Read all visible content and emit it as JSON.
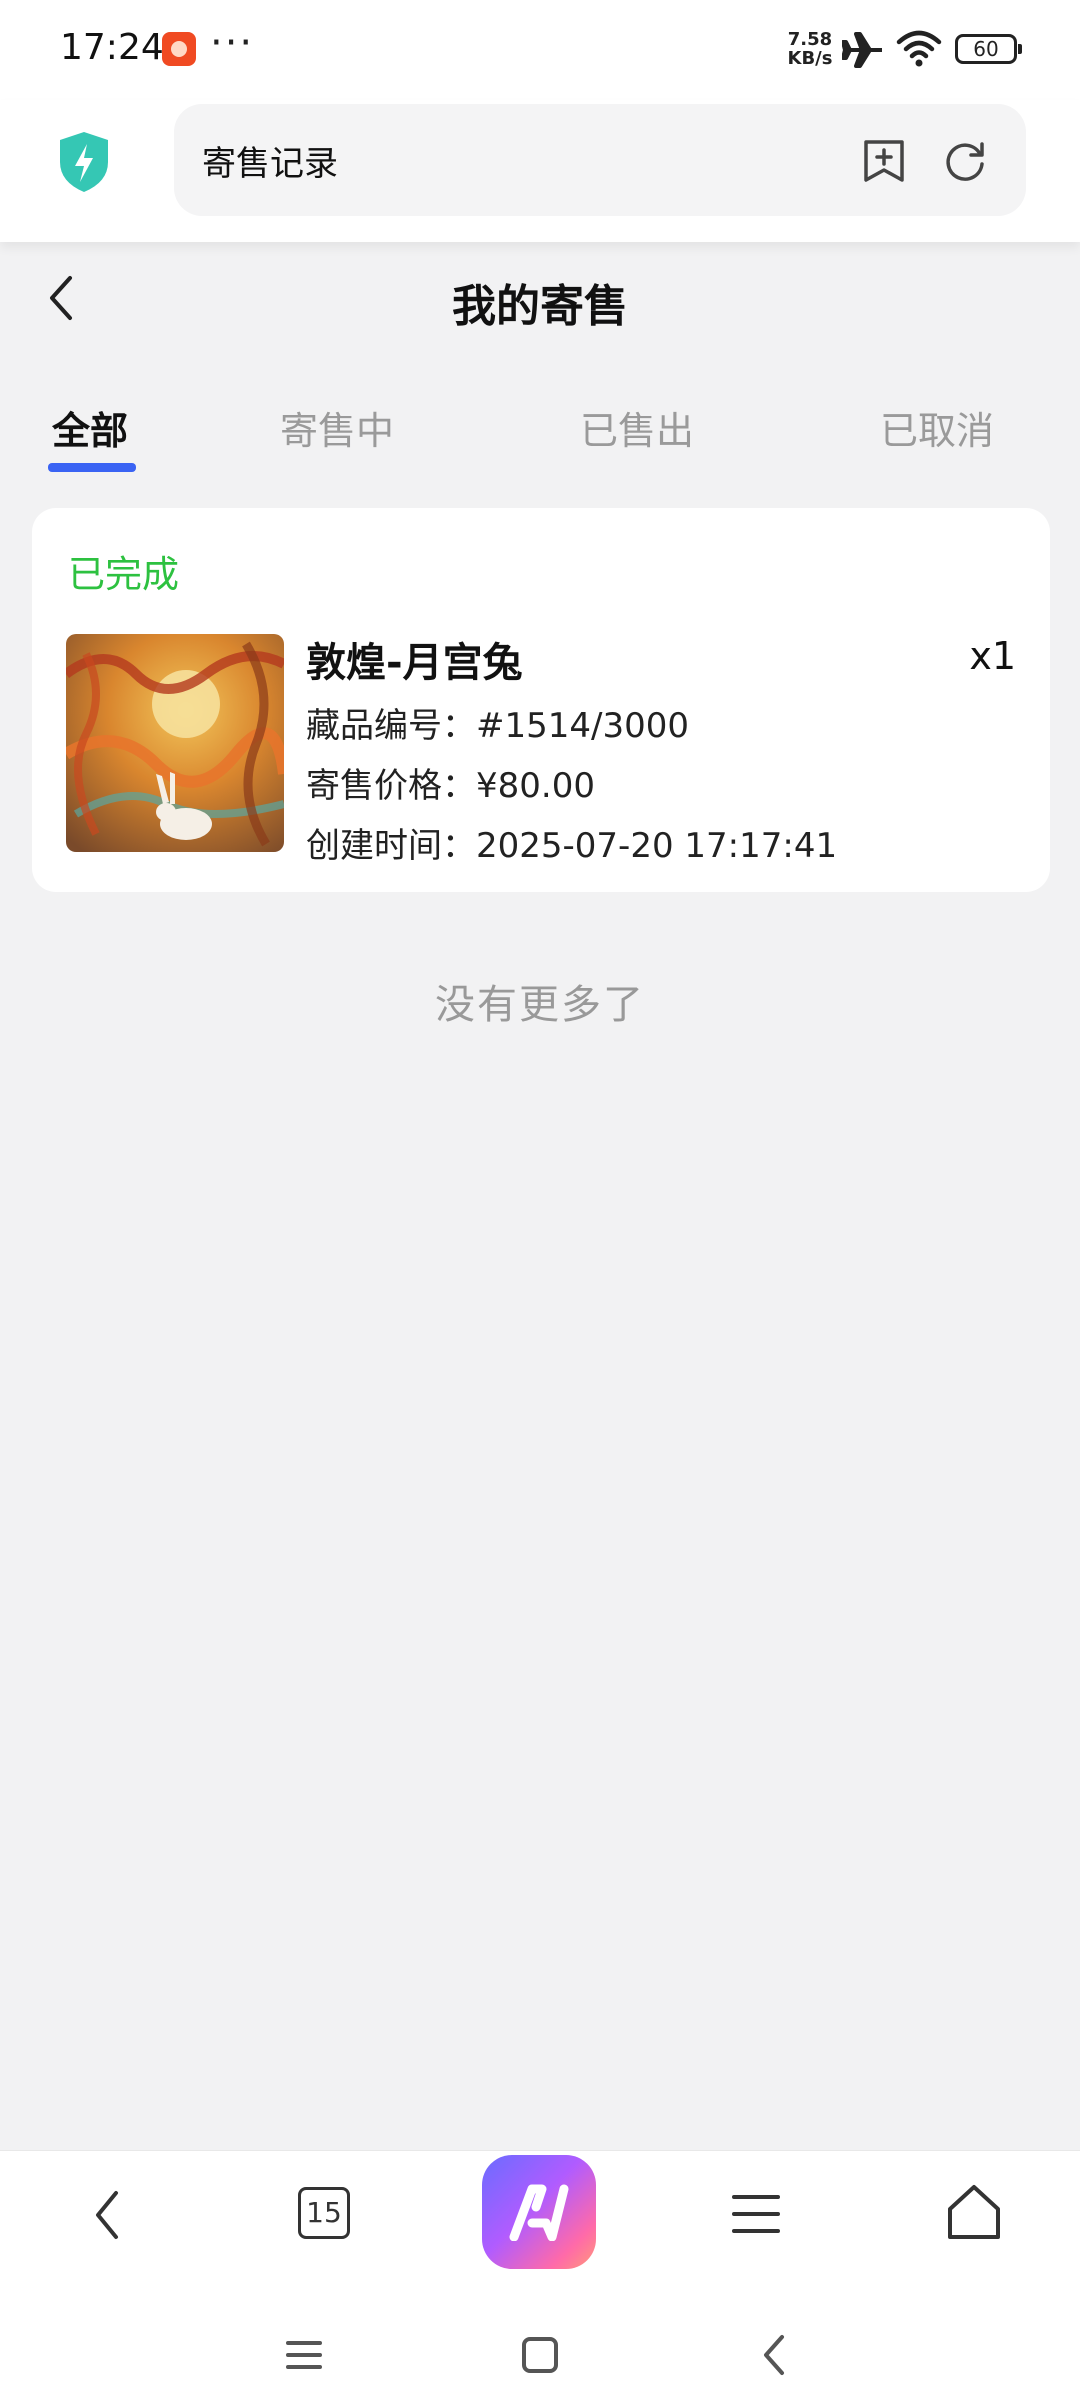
{
  "status_bar": {
    "time": "17:24",
    "more": "···",
    "net_speed_value": "7.58",
    "net_speed_unit": "KB/s",
    "battery": "60"
  },
  "browser": {
    "address_text": "寄售记录",
    "open_tab_count": "15"
  },
  "page": {
    "title": "我的寄售"
  },
  "tabs": [
    {
      "label": "全部",
      "active": true
    },
    {
      "label": "寄售中",
      "active": false
    },
    {
      "label": "已售出",
      "active": false
    },
    {
      "label": "已取消",
      "active": false
    }
  ],
  "orders": [
    {
      "status": "已完成",
      "name": "敦煌-月宫兔",
      "quantity": "x1",
      "serial_label": "藏品编号：",
      "serial_value": "#1514/3000",
      "price_label": "寄售价格：",
      "price_value": "¥80.00",
      "created_label": "创建时间：",
      "created_value": "2025-07-20 17:17:41"
    }
  ],
  "list_end_text": "没有更多了",
  "colors": {
    "accent": "#3a63f3",
    "status_done": "#2dc140",
    "shield": "#35c7b4"
  },
  "icons": [
    "shield-icon",
    "bookmark-add-icon",
    "refresh-icon",
    "back-icon",
    "home-icon",
    "menu-icon",
    "square-icon"
  ]
}
